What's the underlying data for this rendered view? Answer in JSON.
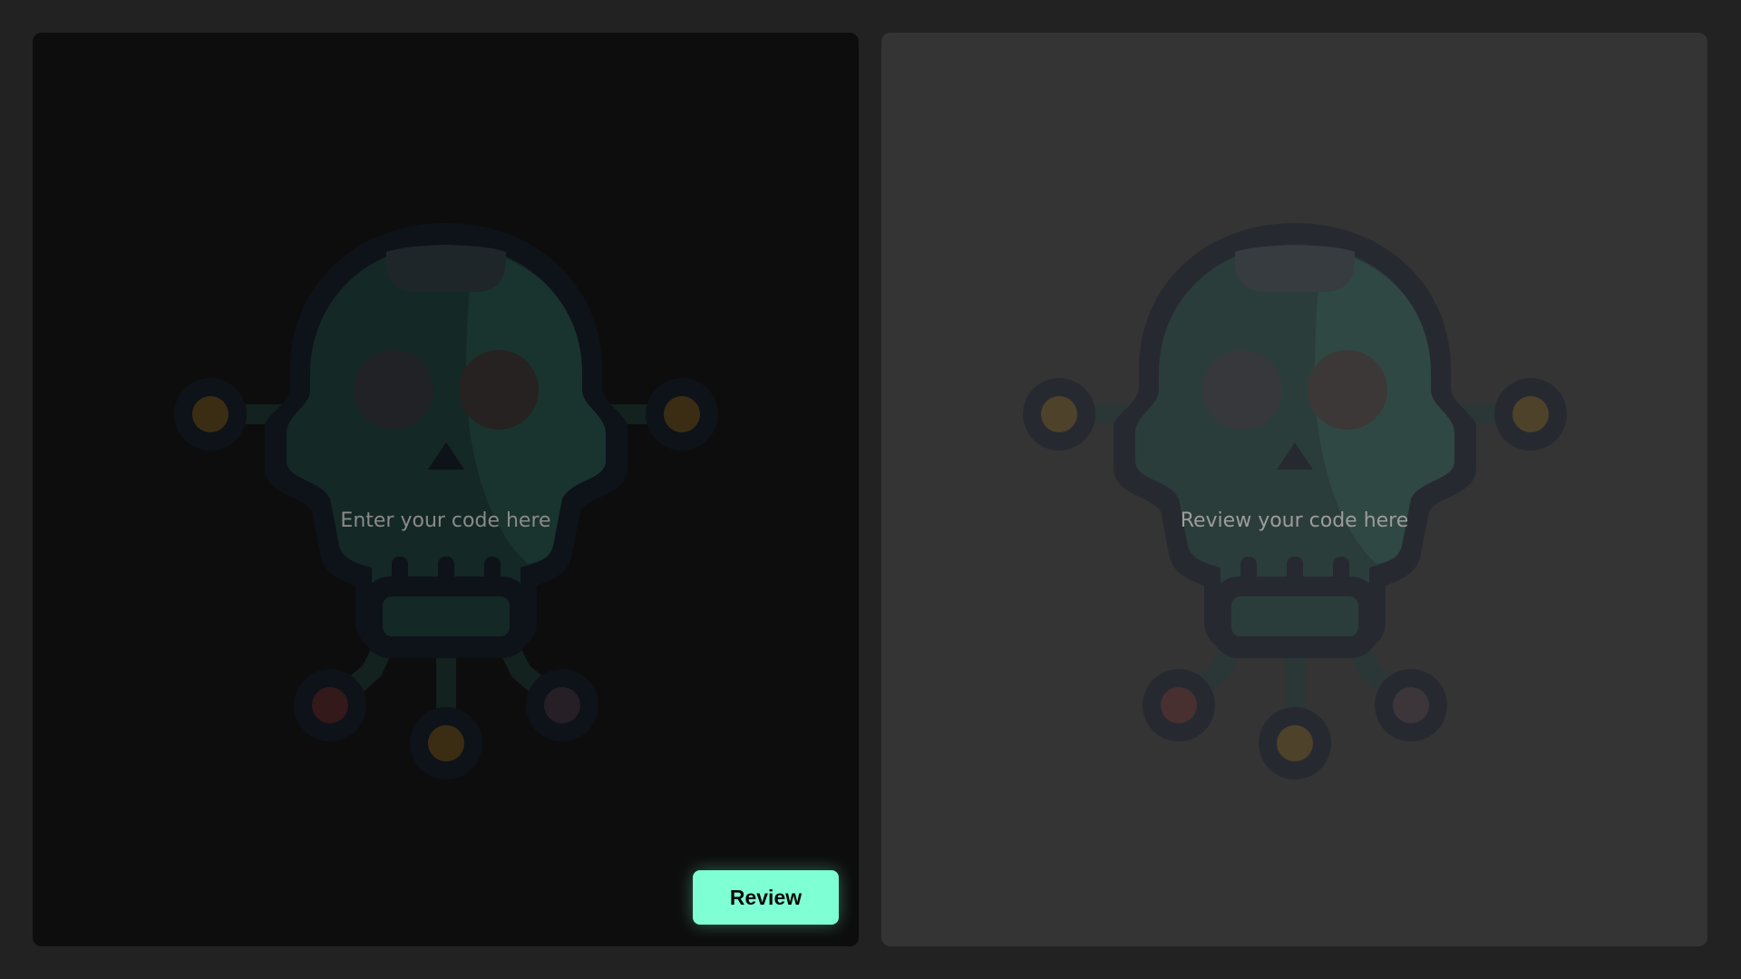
{
  "editor": {
    "placeholder": "Enter your code here",
    "value": ""
  },
  "output": {
    "placeholder": "Review your code here"
  },
  "actions": {
    "review_label": "Review"
  },
  "theme": {
    "page_background": "#222222",
    "editor_background": "#0d0d0d",
    "output_background": "#343434",
    "accent": "#7fffd4"
  },
  "icons": {
    "watermark": "robot-skull-icon"
  }
}
